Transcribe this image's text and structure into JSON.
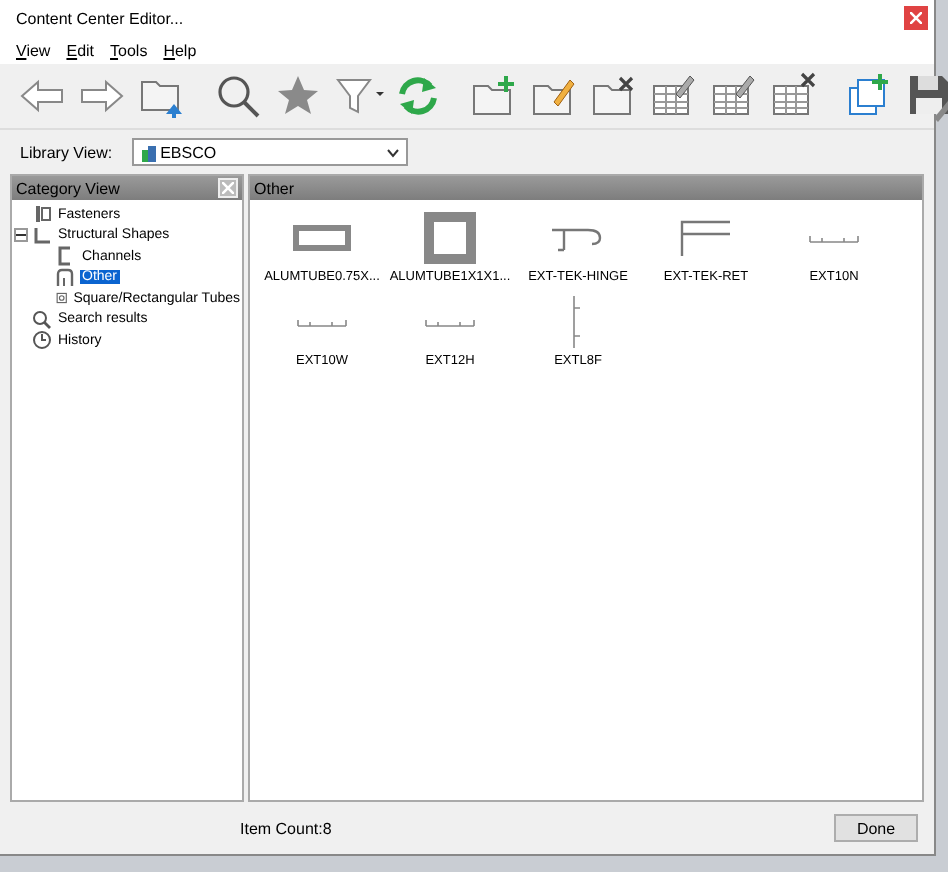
{
  "window": {
    "title": "Content Center Editor..."
  },
  "menu": [
    {
      "label": "View"
    },
    {
      "label": "Edit"
    },
    {
      "label": "Tools"
    },
    {
      "label": "Help"
    }
  ],
  "toolbar": [
    {
      "kind": "back"
    },
    {
      "kind": "forward"
    },
    {
      "kind": "folder-up"
    },
    {
      "kind": "sep"
    },
    {
      "kind": "search"
    },
    {
      "kind": "star"
    },
    {
      "kind": "filter"
    },
    {
      "kind": "refresh"
    },
    {
      "kind": "sep"
    },
    {
      "kind": "folder-add"
    },
    {
      "kind": "folder-edit"
    },
    {
      "kind": "folder-delete"
    },
    {
      "kind": "table-edit"
    },
    {
      "kind": "table-edit"
    },
    {
      "kind": "table-delete"
    },
    {
      "kind": "sep"
    },
    {
      "kind": "copy-add"
    },
    {
      "kind": "save"
    }
  ],
  "library_view": {
    "label": "Library View:",
    "value": "EBSCO"
  },
  "category_view": {
    "title": "Category View",
    "tree": [
      {
        "label": "Fasteners",
        "kind": "fastener",
        "selected": false
      },
      {
        "label": "Structural Shapes",
        "kind": "shape",
        "expanded": true,
        "selected": false,
        "children": [
          {
            "label": "Channels",
            "kind": "channel",
            "selected": false
          },
          {
            "label": "Other",
            "kind": "other",
            "selected": true
          },
          {
            "label": "Square/Rectangular Tubes",
            "kind": "tube",
            "selected": false
          }
        ]
      },
      {
        "label": "Search results",
        "kind": "search",
        "selected": false
      },
      {
        "label": "History",
        "kind": "history",
        "selected": false
      }
    ]
  },
  "content": {
    "title": "Other",
    "items": [
      {
        "label": "ALUMTUBE0.75X...",
        "kind": "rect-tube"
      },
      {
        "label": "ALUMTUBE1X1X1...",
        "kind": "square-tube"
      },
      {
        "label": "EXT-TEK-HINGE",
        "kind": "hinge"
      },
      {
        "label": "EXT-TEK-RET",
        "kind": "ret"
      },
      {
        "label": "EXT10N",
        "kind": "flat"
      },
      {
        "label": "EXT10W",
        "kind": "flat"
      },
      {
        "label": "EXT12H",
        "kind": "flat"
      },
      {
        "label": "EXTL8F",
        "kind": "vertical"
      }
    ]
  },
  "status": {
    "item_count": "Item Count:8"
  },
  "buttons": [
    {
      "label": "Done"
    }
  ]
}
